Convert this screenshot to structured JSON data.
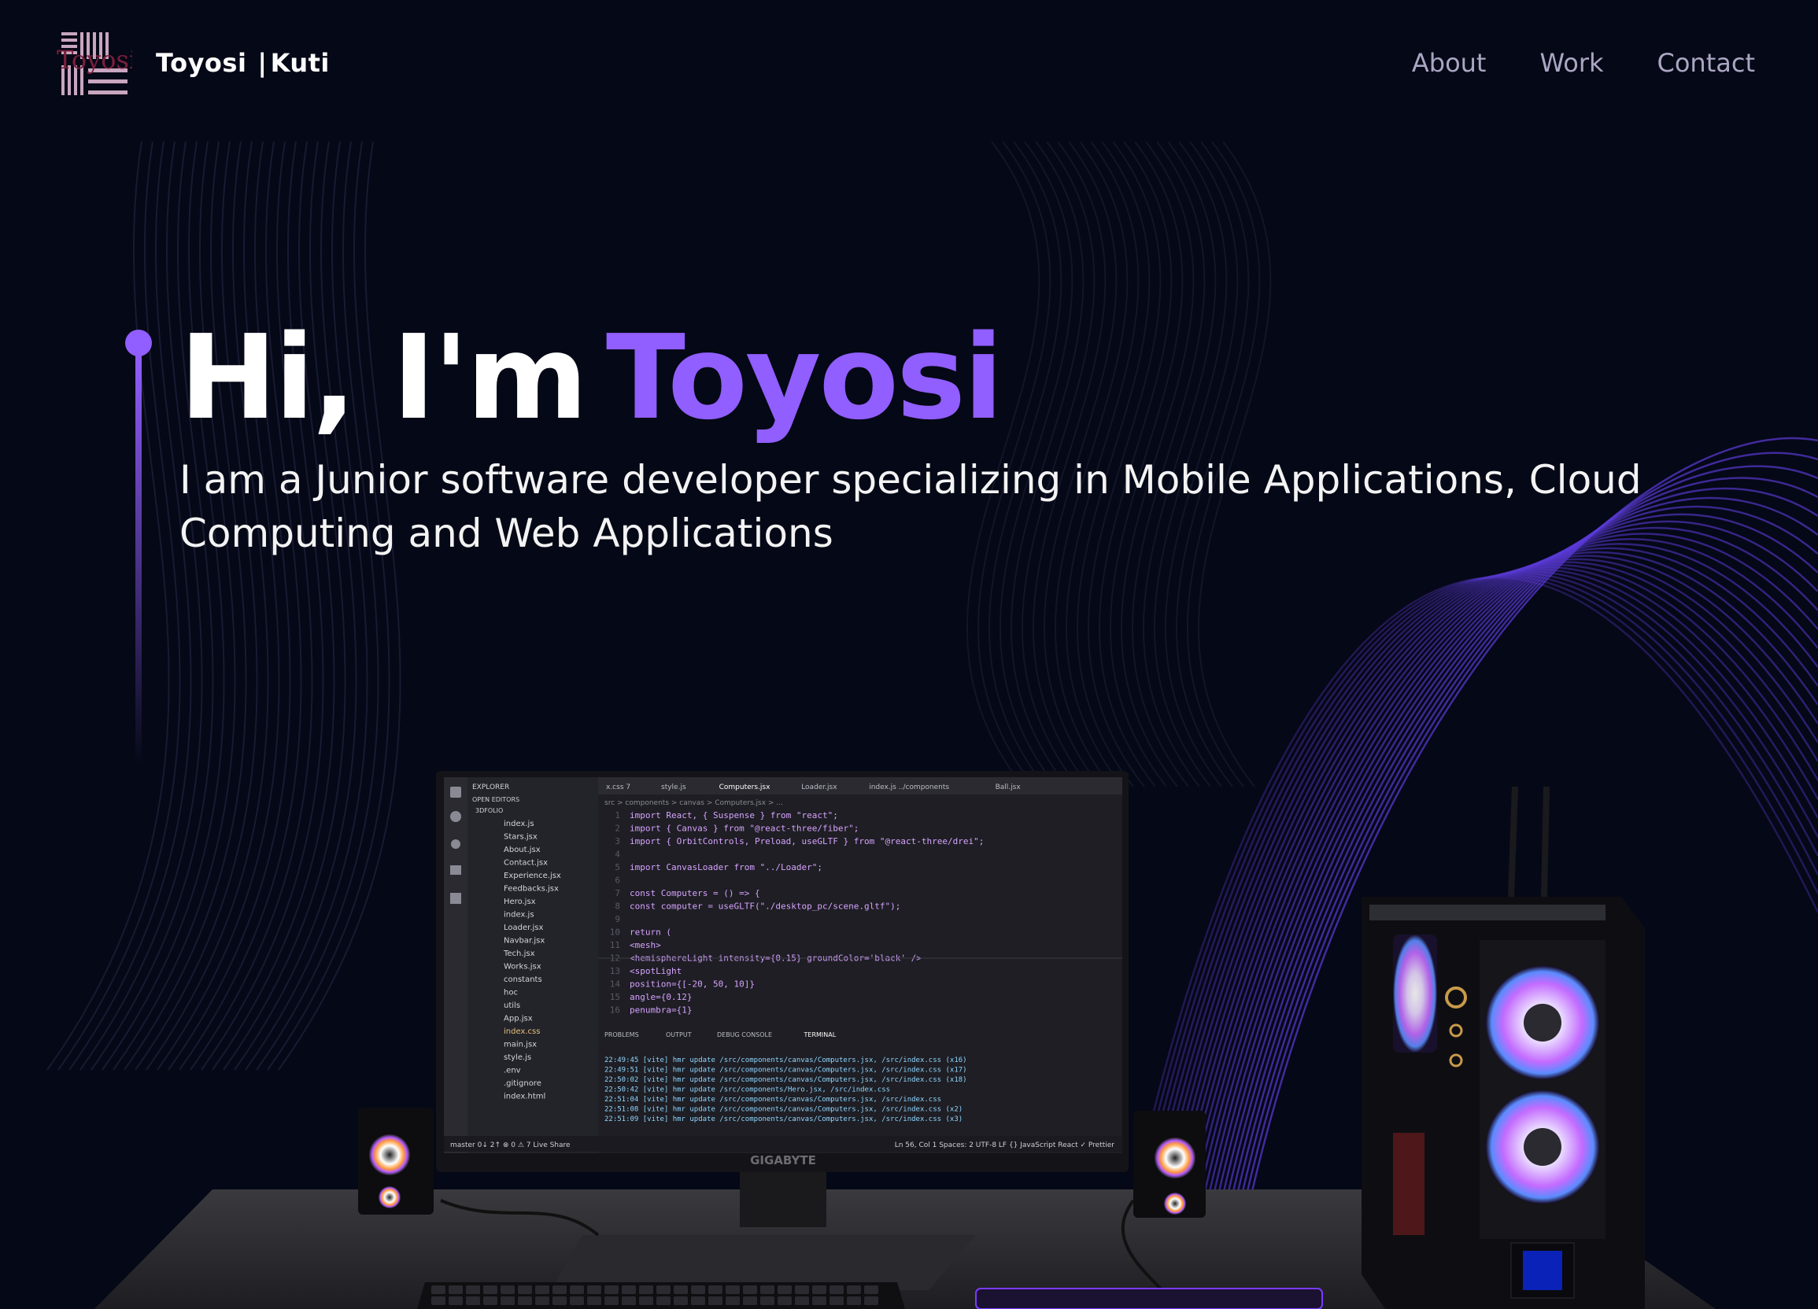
{
  "navbar": {
    "logo_text": "Toyosi",
    "brand_first": "Toyosi",
    "brand_separator": "|",
    "brand_last": "Kuti",
    "links": [
      "About",
      "Work",
      "Contact"
    ]
  },
  "hero": {
    "greeting": "Hi, I'm",
    "name": "Toyosi",
    "subtitle": "I am a Junior software developer specializing in Mobile Applications, Cloud Computing and Web Applications"
  },
  "scene": {
    "monitor_brand": "GIGABYTE",
    "editor": {
      "panel_title": "EXPLORER",
      "section_open_editors": "OPEN EDITORS",
      "project": "3DFOLIO",
      "tabs": [
        "x.css 7",
        "style.js",
        "Computers.jsx",
        "Loader.jsx",
        "index.js ../components",
        "Ball.jsx"
      ],
      "breadcrumb": "src > components > canvas > Computers.jsx > ...",
      "files": [
        "index.js",
        "Stars.jsx",
        "About.jsx",
        "Contact.jsx",
        "Experience.jsx",
        "Feedbacks.jsx",
        "Hero.jsx",
        "index.js",
        "Loader.jsx",
        "Navbar.jsx",
        "Tech.jsx",
        "Works.jsx",
        "constants",
        "hoc",
        "utils",
        "App.jsx",
        "index.css",
        "main.jsx",
        "style.js",
        ".env",
        ".gitignore",
        "index.html"
      ],
      "code_lines": [
        "import React, { Suspense } from \"react\";",
        "import { Canvas } from \"@react-three/fiber\";",
        "import { OrbitControls, Preload, useGLTF } from \"@react-three/drei\";",
        "",
        "import CanvasLoader from \"../Loader\";",
        "",
        "const Computers = () => {",
        "  const computer = useGLTF(\"./desktop_pc/scene.gltf\");",
        "",
        "  return (",
        "    <mesh>",
        "      <hemisphereLight intensity={0.15} groundColor='black' />",
        "      <spotLight",
        "        position={[-20, 50, 10]}",
        "        angle={0.12}",
        "        penumbra={1}"
      ],
      "panel_tabs": [
        "PROBLEMS",
        "OUTPUT",
        "DEBUG CONSOLE",
        "TERMINAL"
      ],
      "terminal_lines": [
        "22:49:45 [vite] hmr update /src/components/canvas/Computers.jsx, /src/index.css (x16)",
        "22:49:51 [vite] hmr update /src/components/canvas/Computers.jsx, /src/index.css (x17)",
        "22:50:02 [vite] hmr update /src/components/canvas/Computers.jsx, /src/index.css (x18)",
        "22:50:42 [vite] hmr update /src/components/Hero.jsx, /src/index.css",
        "22:51:04 [vite] hmr update /src/components/canvas/Computers.jsx, /src/index.css",
        "22:51:08 [vite] hmr update /src/components/canvas/Computers.jsx, /src/index.css (x2)",
        "22:51:09 [vite] hmr update /src/components/canvas/Computers.jsx, /src/index.css (x3)"
      ],
      "status_left": "master  0↓ 2↑  ⊗ 0 ⚠ 7  Live Share",
      "status_right": "Ln 56, Col 1  Spaces: 2  UTF-8  LF  {} JavaScript React  ✓ Prettier"
    }
  },
  "colors": {
    "background": "#050816",
    "accent": "#915eff",
    "nav_link": "#aaa6c3",
    "logo": "#c8a6c0"
  }
}
